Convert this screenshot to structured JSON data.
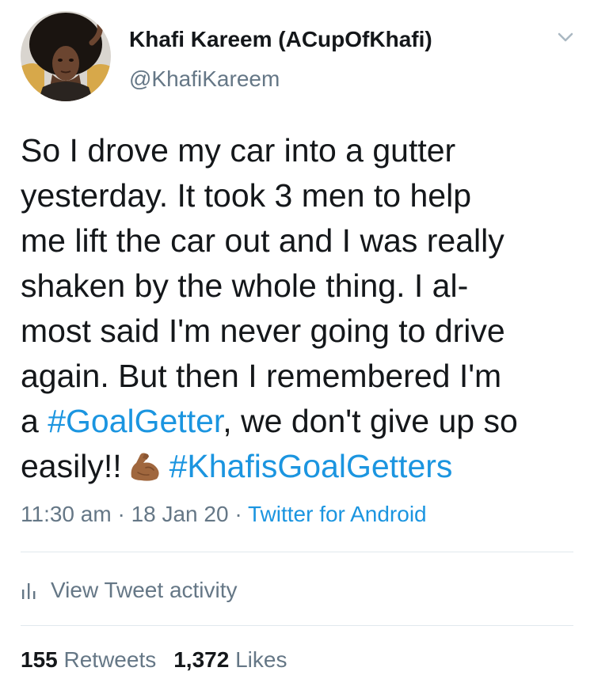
{
  "user": {
    "display_name": "Khafi Kareem (ACupOfKhafi)",
    "handle": "@KhafiKareem"
  },
  "tweet": {
    "line1": "So I drove my car into a gutter",
    "line2": "yesterday. It took 3 men to help",
    "line3": "me lift the car out and I was really",
    "line4": "shaken by the whole thing. I al-",
    "line5": "most said I'm never going to drive",
    "line6": "again. But then I remembered I'm",
    "line7_prefix": "a ",
    "hashtag1": "#GoalGetter",
    "line7_suffix": ", we don't give up so",
    "line8_prefix": "easily!!",
    "emoji_name": "flexed-biceps-medium-dark-skin-tone",
    "hashtag2": "#KhafisGoalGetters"
  },
  "meta": {
    "time": "11:30 am",
    "separator": " · ",
    "date": "18 Jan 20",
    "source": "Twitter for Android"
  },
  "activity": {
    "icon": "bar-chart-icon",
    "label": "View Tweet activity"
  },
  "stats": {
    "retweets_count": "155",
    "retweets_label": "Retweets",
    "likes_count": "1,372",
    "likes_label": "Likes"
  },
  "colors": {
    "link": "#1b95e0",
    "secondary_text": "#657786",
    "primary_text": "#14171a",
    "divider": "#e1e8ed"
  }
}
